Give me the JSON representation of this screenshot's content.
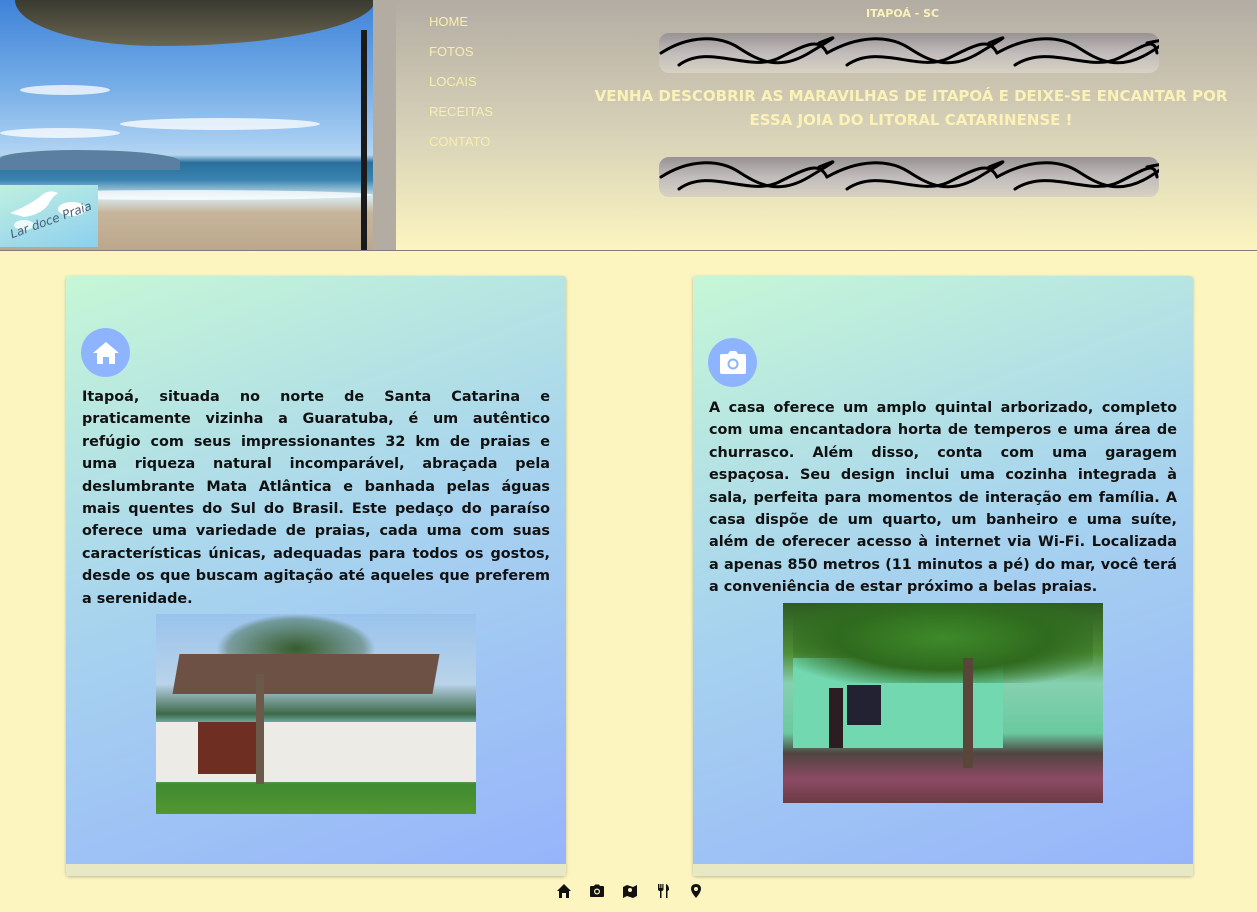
{
  "header": {
    "title": "ITAPOÁ - SC",
    "slogan": "VENHA DESCOBRIR AS MARAVILHAS DE ITAPOÁ E DEIXE-SE ENCANTAR POR ESSA JOIA DO LITORAL CATARINENSE !",
    "logo_text": "Lar doce Praia",
    "nav": [
      "HOME",
      "FOTOS",
      "LOCAIS",
      "RECEITAS",
      "CONTATO"
    ]
  },
  "cards": [
    {
      "icon": "home-icon",
      "text": "Itapoá, situada no norte de Santa Catarina e praticamente vizinha a Guaratuba, é um autêntico refúgio com seus impressionantes 32 km de praias e uma riqueza natural incomparável, abraçada pela deslumbrante Mata Atlântica e banhada pelas águas mais quentes do Sul do Brasil. Este pedaço do paraíso oferece uma variedade de praias, cada uma com suas características únicas, adequadas para todos os gostos, desde os que buscam agitação até aqueles que preferem a serenidade."
    },
    {
      "icon": "camera-icon",
      "text": "A casa oferece um amplo quintal arborizado, completo com uma encantadora horta de temperos e uma área de churrasco. Além disso, conta com uma garagem espaçosa. Seu design inclui uma cozinha integrada à sala, perfeita para momentos de interação em família. A casa dispõe de um quarto, um banheiro e uma suíte, além de oferecer acesso à internet via Wi-Fi. Localizada a apenas 850 metros (11 minutos a pé) do mar, você terá a conveniência de estar próximo a belas praias."
    }
  ],
  "footer_icons": [
    "home-icon",
    "camera-icon",
    "map-icon",
    "utensils-icon",
    "location-pin-icon"
  ],
  "colors": {
    "background": "#fcf5c0",
    "nav_text": "#f7efb0",
    "icon_circle": "#8fb4ff",
    "card_gradient_start": "#c6f7d6",
    "card_gradient_end": "#96b3fb"
  }
}
